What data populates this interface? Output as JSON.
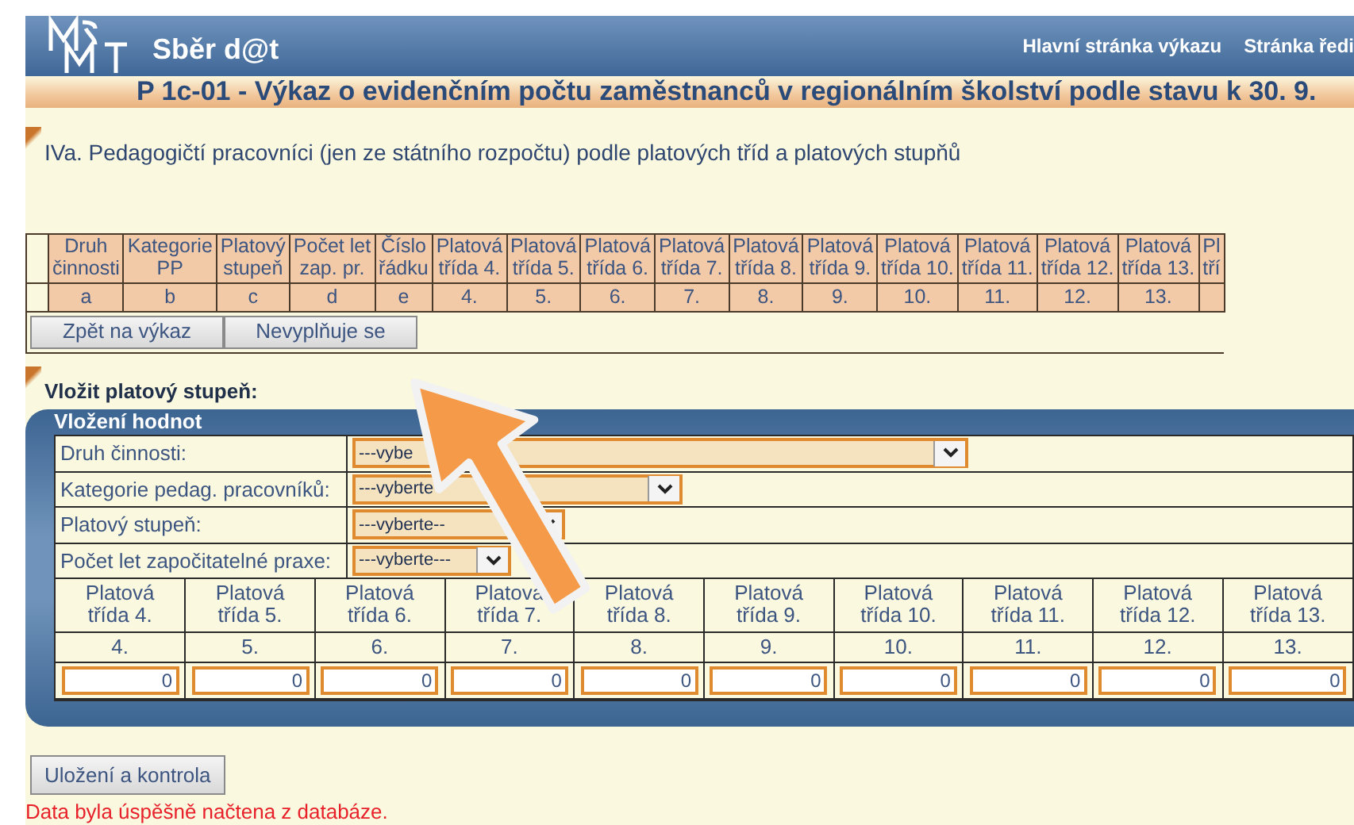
{
  "header": {
    "app_title": "Sběr d@t",
    "nav_links": [
      "Hlavní stránka výkazu",
      "Stránka ředi"
    ]
  },
  "report_title": "P 1c-01 - Výkaz o evidenčním počtu zaměstnanců v regionálním školství podle stavu k 30. 9.",
  "section_title": "IVa. Pedagogičtí pracovníci (jen ze státního rozpočtu) podle platových tříd a platových stupňů",
  "summary_table": {
    "columns": [
      {
        "label": "Druh\nčinnosti",
        "code": "a"
      },
      {
        "label": "Kategorie\nPP",
        "code": "b"
      },
      {
        "label": "Platový\nstupeň",
        "code": "c"
      },
      {
        "label": "Počet let\nzap. pr.",
        "code": "d"
      },
      {
        "label": "Číslo\nřádku",
        "code": "e"
      },
      {
        "label": "Platová\ntřída 4.",
        "code": "4."
      },
      {
        "label": "Platová\ntřída 5.",
        "code": "5."
      },
      {
        "label": "Platová\ntřída 6.",
        "code": "6."
      },
      {
        "label": "Platová\ntřída 7.",
        "code": "7."
      },
      {
        "label": "Platová\ntřída 8.",
        "code": "8."
      },
      {
        "label": "Platová\ntřída 9.",
        "code": "9."
      },
      {
        "label": "Platová\ntřída 10.",
        "code": "10."
      },
      {
        "label": "Platová\ntřída 11.",
        "code": "11."
      },
      {
        "label": "Platová\ntřída 12.",
        "code": "12."
      },
      {
        "label": "Platová\ntřída 13.",
        "code": "13."
      },
      {
        "label": "Pl\ntří"
      }
    ],
    "buttons": [
      "Zpět na výkaz",
      "Nevyplňuje se"
    ]
  },
  "form": {
    "heading": "Vložit platový stupeň:",
    "panel_title": "Vložení hodnot",
    "fields": [
      {
        "label": "Druh činnosti:",
        "value": "---vybe"
      },
      {
        "label": "Kategorie pedag. pracovníků:",
        "value": "---vyberte"
      },
      {
        "label": "Platový stupeň:",
        "value": "---vyberte--"
      },
      {
        "label": "Počet let započitatelné praxe:",
        "value": "---vyberte---"
      }
    ],
    "grades": [
      {
        "label": "Platová\ntřída 4.",
        "code": "4.",
        "value": "0"
      },
      {
        "label": "Platová\ntřída 5.",
        "code": "5.",
        "value": "0"
      },
      {
        "label": "Platová\ntřída 6.",
        "code": "6.",
        "value": "0"
      },
      {
        "label": "Platová\ntřída 7.",
        "code": "7.",
        "value": "0"
      },
      {
        "label": "Platová\ntřída 8.",
        "code": "8.",
        "value": "0"
      },
      {
        "label": "Platová\ntřída 9.",
        "code": "9.",
        "value": "0"
      },
      {
        "label": "Platová\ntřída 10.",
        "code": "10.",
        "value": "0"
      },
      {
        "label": "Platová\ntřída 11.",
        "code": "11.",
        "value": "0"
      },
      {
        "label": "Platová\ntřída 12.",
        "code": "12.",
        "value": "0"
      },
      {
        "label": "Platová\ntřída 13.",
        "code": "13.",
        "value": "0"
      }
    ]
  },
  "save_button": "Uložení a kontrola",
  "message": "Data byla úspěšně načtena z databáze."
}
